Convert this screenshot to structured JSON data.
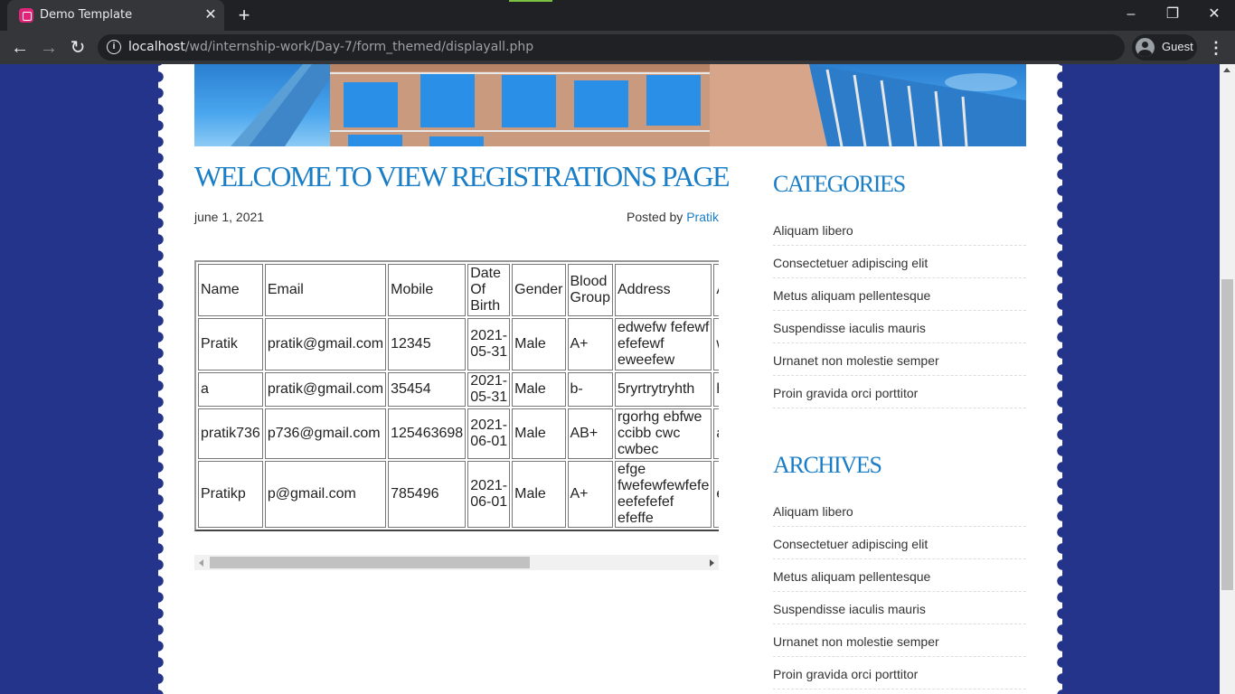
{
  "browser": {
    "tab_title": "Demo Template",
    "url_host": "localhost",
    "url_path": "/wd/internship-work/Day-7/form_themed/displayall.php",
    "profile_label": "Guest"
  },
  "post": {
    "title": "WELCOME TO VIEW REGISTRATIONS PAGE",
    "date": "june 1, 2021",
    "posted_by_prefix": "Posted by ",
    "author": "Pratik"
  },
  "table": {
    "headers": [
      "Name",
      "Email",
      "Mobile",
      "Date Of Birth",
      "Gender",
      "Blood Group",
      "Address",
      "Ar"
    ],
    "rows": [
      [
        "Pratik",
        "pratik@gmail.com",
        "12345",
        "2021-05-31",
        "Male",
        "A+",
        "edwefw fefewf efefewf eweefew",
        "wg"
      ],
      [
        "a",
        "pratik@gmail.com",
        "35454",
        "2021-05-31",
        "Male",
        "b-",
        "5ryrtrytryhth",
        "ht"
      ],
      [
        "pratik736",
        "p736@gmail.com",
        "125463698",
        "2021-06-01",
        "Male",
        "AB+",
        "rgorhg ebfwe ccibb cwc cwbec",
        "ae"
      ],
      [
        "Pratikp",
        "p@gmail.com",
        "785496",
        "2021-06-01",
        "Male",
        "A+",
        "efge fwefewfewfefe eefefefef efeffe",
        "eg"
      ]
    ]
  },
  "sidebar": {
    "categories_title": "CATEGORIES",
    "categories": [
      "Aliquam libero",
      "Consectetuer adipiscing elit",
      "Metus aliquam pellentesque",
      "Suspendisse iaculis mauris",
      "Urnanet non molestie semper",
      "Proin gravida orci porttitor"
    ],
    "archives_title": "ARCHIVES",
    "archives": [
      "Aliquam libero",
      "Consectetuer adipiscing elit",
      "Metus aliquam pellentesque",
      "Suspendisse iaculis mauris",
      "Urnanet non molestie semper",
      "Proin gravida orci porttitor"
    ]
  },
  "icons": {
    "close": "close-icon",
    "new_tab": "plus-icon",
    "back": "arrow-left-icon",
    "forward": "arrow-right-icon",
    "reload": "reload-icon",
    "info": "info-icon",
    "profile": "avatar-icon",
    "menu": "kebab-menu-icon"
  },
  "colors": {
    "page_background": "#24348a",
    "accent": "#1a7ec7",
    "chrome_dark": "#202124",
    "chrome_toolbar": "#35363a"
  }
}
